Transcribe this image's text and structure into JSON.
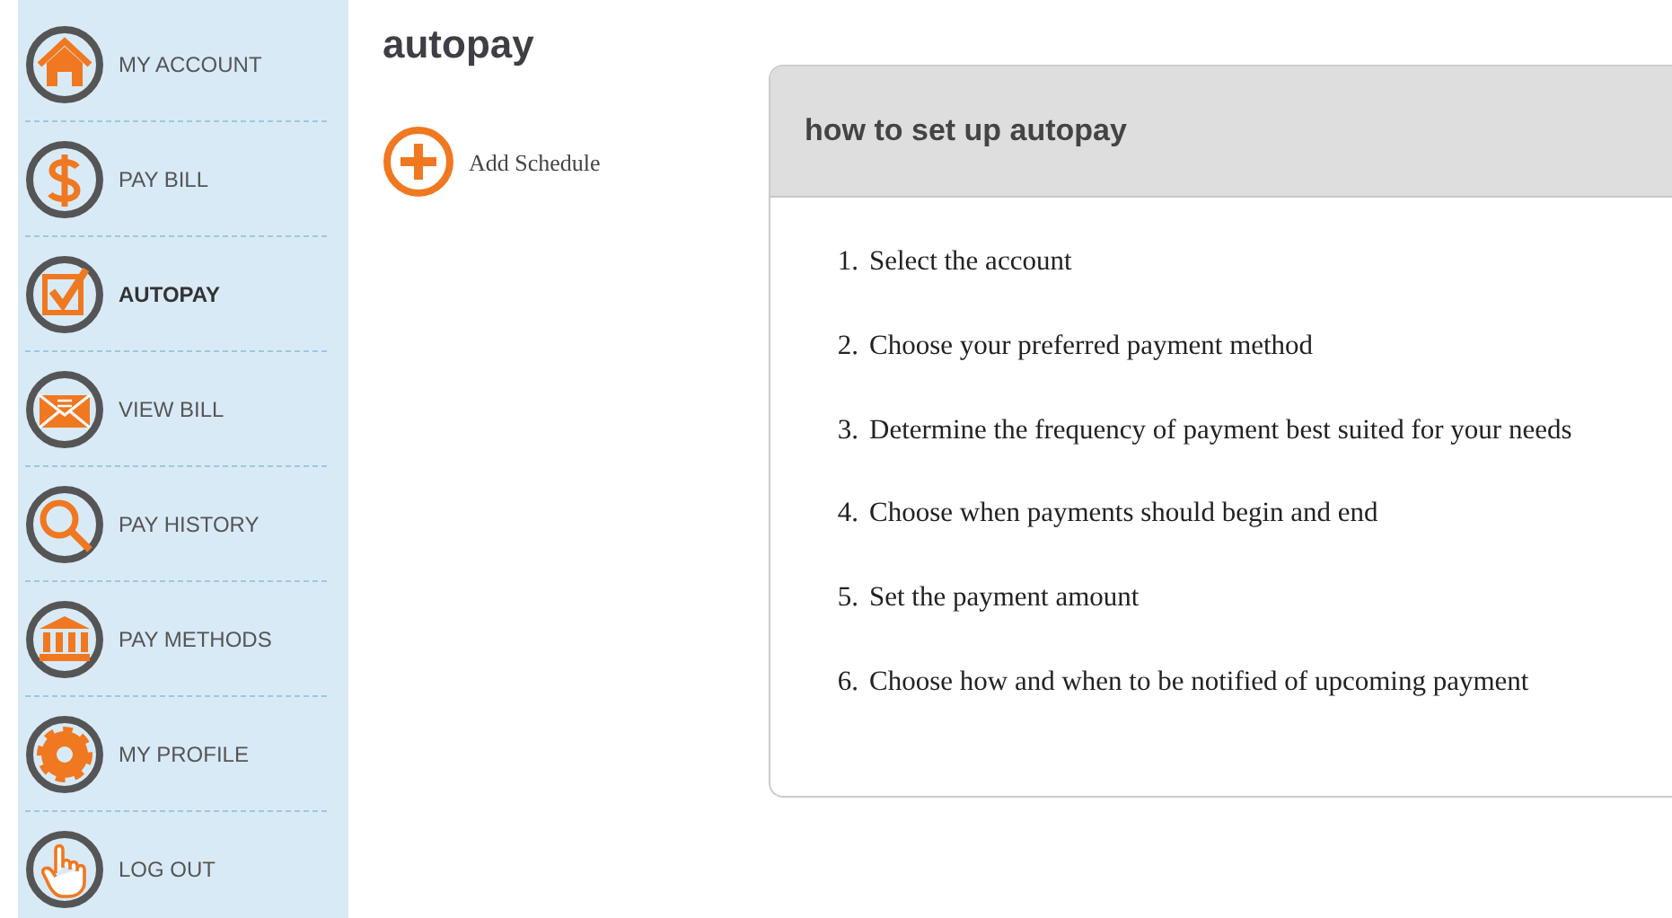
{
  "sidebar": {
    "items": [
      {
        "label": "MY ACCOUNT",
        "selected": false
      },
      {
        "label": "PAY BILL",
        "selected": false
      },
      {
        "label": "AUTOPAY",
        "selected": true
      },
      {
        "label": "VIEW BILL",
        "selected": false
      },
      {
        "label": "PAY HISTORY",
        "selected": false
      },
      {
        "label": "PAY METHODS",
        "selected": false
      },
      {
        "label": "MY PROFILE",
        "selected": false
      },
      {
        "label": "LOG OUT",
        "selected": false
      }
    ]
  },
  "page_title": "autopay",
  "add_schedule": {
    "label": "Add Schedule"
  },
  "help_card": {
    "title": "how to set up autopay",
    "steps": [
      {
        "number": "1.",
        "text": "Select the account"
      },
      {
        "number": "2.",
        "text": "Choose your preferred payment method"
      },
      {
        "number": "3.",
        "text": "Determine the frequency of payment best suited for your needs"
      },
      {
        "number": "4.",
        "text": "Choose when payments should begin and end"
      },
      {
        "number": "5.",
        "text": "Set the payment amount"
      },
      {
        "number": "6.",
        "text": "Choose how and when to be notified of upcoming payment"
      }
    ]
  }
}
